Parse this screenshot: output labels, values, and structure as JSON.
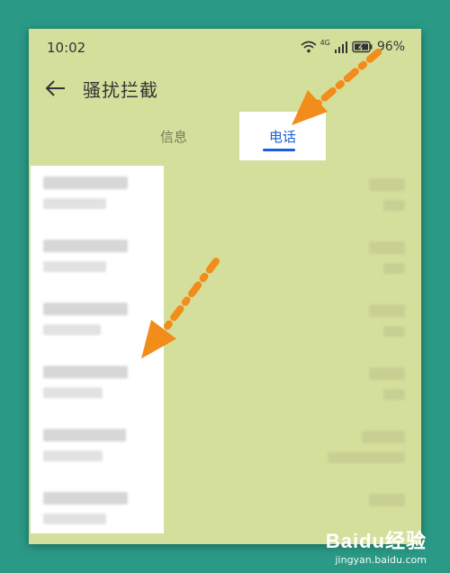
{
  "status": {
    "time": "10:02",
    "network": "4G",
    "battery": "96%"
  },
  "header": {
    "title": "骚扰拦截"
  },
  "tabs": [
    {
      "label": "信息",
      "active": false
    },
    {
      "label": "电话",
      "active": true
    }
  ],
  "colors": {
    "background": "#2a9a86",
    "screen": "#d5df9c",
    "accent": "#1a5fd8",
    "arrow": "#f28c1a"
  },
  "watermark": {
    "logo": "Baidu经验",
    "url": "jingyan.baidu.com"
  }
}
